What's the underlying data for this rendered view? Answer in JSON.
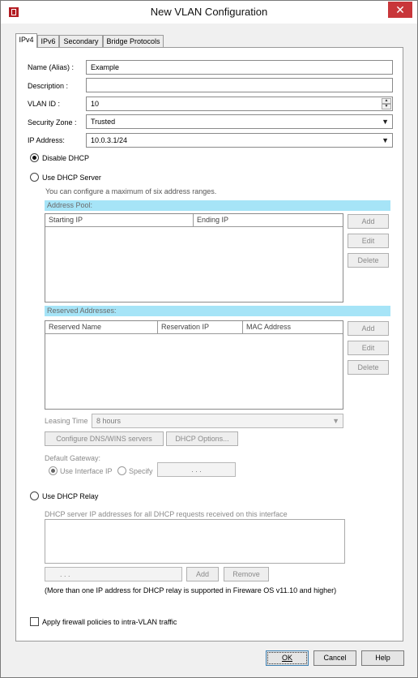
{
  "window": {
    "title": "New VLAN Configuration",
    "close_label": "✕"
  },
  "tabs": [
    "IPv4",
    "IPv6",
    "Secondary",
    "Bridge Protocols"
  ],
  "form": {
    "name_label": "Name (Alias) :",
    "name_value": "Example",
    "description_label": "Description :",
    "description_value": "",
    "vlan_id_label": "VLAN ID :",
    "vlan_id_value": "10",
    "security_zone_label": "Security Zone :",
    "security_zone_value": "Trusted",
    "ip_address_label": "IP Address:",
    "ip_address_value": "10.0.3.1/24"
  },
  "dhcp": {
    "disable_label": "Disable DHCP",
    "server_label": "Use DHCP Server",
    "server_note": "You can configure a maximum of six address ranges.",
    "address_pool_title": "Address Pool:",
    "pool_columns": [
      "Starting IP",
      "Ending IP"
    ],
    "reserved_title": "Reserved Addresses:",
    "reserved_columns": [
      "Reserved Name",
      "Reservation IP",
      "MAC Address"
    ],
    "add_label": "Add",
    "edit_label": "Edit",
    "delete_label": "Delete",
    "leasing_time_label": "Leasing Time",
    "leasing_time_value": "8 hours",
    "configure_dns_label": "Configure DNS/WINS servers",
    "dhcp_options_label": "DHCP Options...",
    "default_gateway_label": "Default Gateway:",
    "use_interface_ip_label": "Use Interface IP",
    "specify_label": "Specify",
    "specify_ip_value": ".      .      .",
    "relay_label": "Use DHCP Relay",
    "relay_note": "DHCP server IP addresses for all DHCP requests received on this interface",
    "relay_ip_value": ".      .      .",
    "relay_add_label": "Add",
    "relay_remove_label": "Remove",
    "relay_footnote": "(More than one IP address for DHCP relay is supported in Fireware OS v11.10 and higher)"
  },
  "firewall_policy_label": "Apply firewall policies to intra-VLAN traffic",
  "footer": {
    "ok_label": "OK",
    "cancel_label": "Cancel",
    "help_label": "Help"
  },
  "colors": {
    "section_bar": "#a6e4f7",
    "close_button": "#c8363a",
    "default_button_border": "#3c7fb1"
  }
}
